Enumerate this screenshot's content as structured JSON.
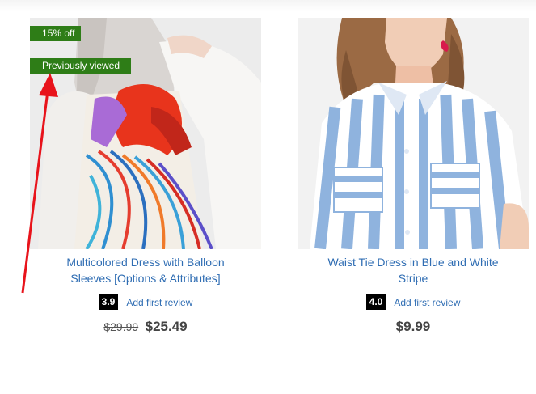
{
  "products": [
    {
      "badges": {
        "discount": "15% off",
        "viewed": "Previously viewed"
      },
      "title": "Multicolored Dress with Balloon Sleeves [Options & Attributes]",
      "rating": "3.9",
      "review_link": "Add first review",
      "old_price": "$29.99",
      "price": "$25.49"
    },
    {
      "title": "Waist Tie Dress in Blue and White Stripe",
      "rating": "4.0",
      "review_link": "Add first review",
      "price": "$9.99"
    }
  ],
  "colors": {
    "badge_green": "#2e7d17",
    "link_blue": "#2f6db3",
    "annotation_red": "#e8131b"
  }
}
